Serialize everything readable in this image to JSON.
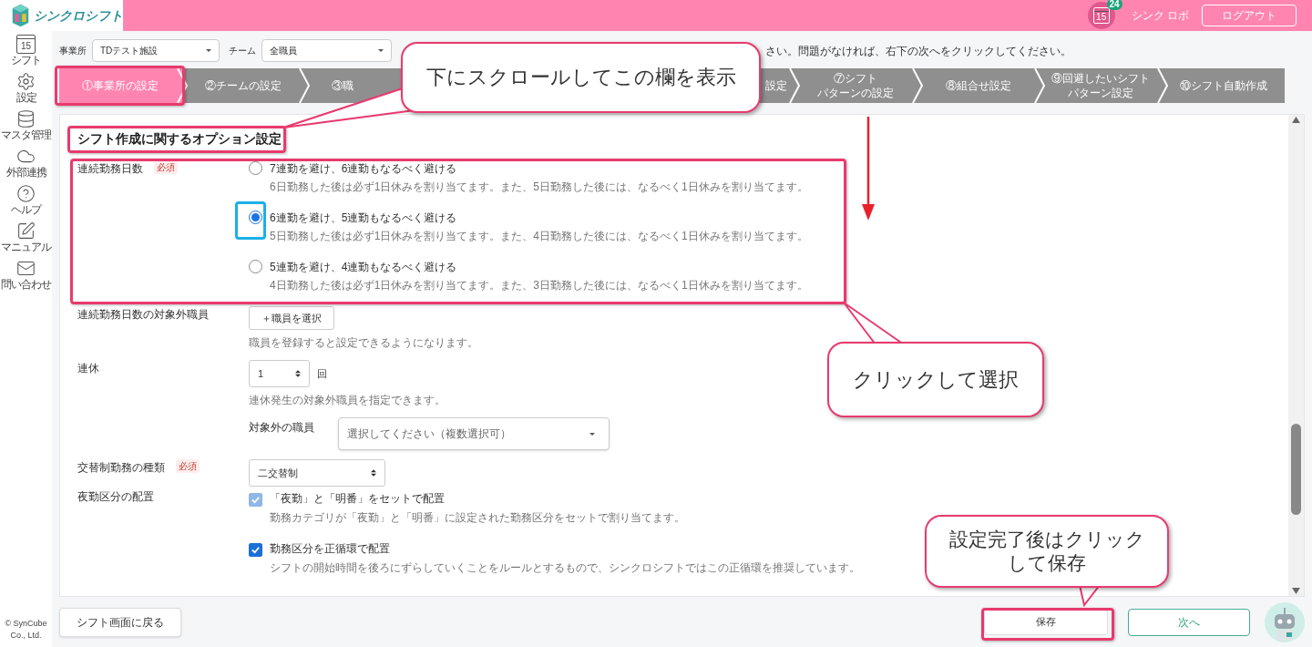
{
  "header": {
    "logo_text": "シンクロシフト",
    "calendar_day": "15",
    "notification_count": "24",
    "user_name": "シンク ロボ",
    "logout_button": "ログアウト"
  },
  "sidebar": {
    "items": [
      {
        "kind": "calendar",
        "day": "15",
        "label": "シフト"
      },
      {
        "kind": "gear",
        "label": "設定"
      },
      {
        "kind": "database",
        "label": "マスタ管理"
      },
      {
        "kind": "cloud",
        "label": "外部連携"
      },
      {
        "kind": "help",
        "label": "ヘルプ"
      },
      {
        "kind": "edit",
        "label": "マニュアル"
      },
      {
        "kind": "mail",
        "label": "問い合わせ"
      }
    ],
    "copyright": "© SynCube Co., Ltd."
  },
  "filters": [
    {
      "label": "事業所",
      "value": "TDテスト施設"
    },
    {
      "label": "チーム",
      "value": "全職員"
    }
  ],
  "instruction": "さい。問題がなければ、右下の次へをクリックしてください。",
  "steps": [
    {
      "lines": [
        "①事業所の設定"
      ],
      "selected": true
    },
    {
      "lines": [
        "②チームの設定"
      ],
      "selected": false
    },
    {
      "lines": [
        "③職"
      ],
      "selected": false,
      "kind": "cut_right"
    },
    {
      "kind": "covered"
    },
    {
      "kind": "covered"
    },
    {
      "lines": [
        "設定"
      ],
      "selected": false,
      "kind": "cut_left"
    },
    {
      "lines": [
        "⑦シフト",
        "パターンの設定"
      ],
      "selected": false
    },
    {
      "lines": [
        "⑧組合せ設定"
      ],
      "selected": false
    },
    {
      "lines": [
        "⑨回避したいシフト",
        "パターン設定"
      ],
      "selected": false
    },
    {
      "lines": [
        "⑩シフト自動作成"
      ],
      "selected": false
    }
  ],
  "section": {
    "title": "シフト作成に関するオプション設定",
    "rows": [
      {
        "kind": "radio",
        "label": "連続勤務日数",
        "required": "必須",
        "options": [
          {
            "title": "7連勤を避け、6連勤もなるべく避ける",
            "description": "6日勤務した後は必ず1日休みを割り当てます。また、5日勤務した後には、なるべく1日休みを割り当てます。",
            "selected": false
          },
          {
            "title": "6連勤を避け、5連勤もなるべく避ける",
            "description": "5日勤務した後は必ず1日休みを割り当てます。また、4日勤務した後には、なるべく1日休みを割り当てます。",
            "selected": true
          },
          {
            "title": "5連勤を避け、4連勤もなるべく避ける",
            "description": "4日勤務した後は必ず1日休みを割り当てます。また、3日勤務した後には、なるべく1日休みを割り当てます。",
            "selected": false
          }
        ]
      },
      {
        "kind": "button",
        "label": "連続勤務日数の対象外職員",
        "button": "＋職員を選択",
        "note": "職員を登録すると設定できるようになります。"
      },
      {
        "kind": "number",
        "label": "連休",
        "value": "1",
        "unit": "回",
        "note": "連休発生の対象外職員を指定できます。",
        "sub_field": {
          "label": "対象外の職員",
          "placeholder": "選択してください（複数選択可）"
        }
      },
      {
        "kind": "select",
        "label": "交替制勤務の種類",
        "required": "必須",
        "value": "二交替制"
      },
      {
        "kind": "checkboxes",
        "label": "夜勤区分の配置",
        "items": [
          {
            "title": "「夜勤」と「明番」をセットで配置",
            "description": "勤務カテゴリが「夜勤」と「明番」に設定された勤務区分をセットで割り当てます。",
            "checked": true,
            "disabled": true
          },
          {
            "title": "勤務区分を正循環で配置",
            "description": "シフトの開始時間を後ろにずらしていくことをルールとするもので、シンクロシフトではこの正循環を推奨しています。",
            "checked": true,
            "disabled": false
          }
        ]
      }
    ]
  },
  "footer": {
    "back_button": "シフト画面に戻る",
    "save_button": "保存",
    "next_button": "次へ"
  },
  "annotations": {
    "callouts": [
      {
        "text": "下にスクロールしてこの欄を表示"
      },
      {
        "text": "クリックして選択"
      },
      {
        "text": "設定完了後はクリックして保存"
      }
    ]
  }
}
